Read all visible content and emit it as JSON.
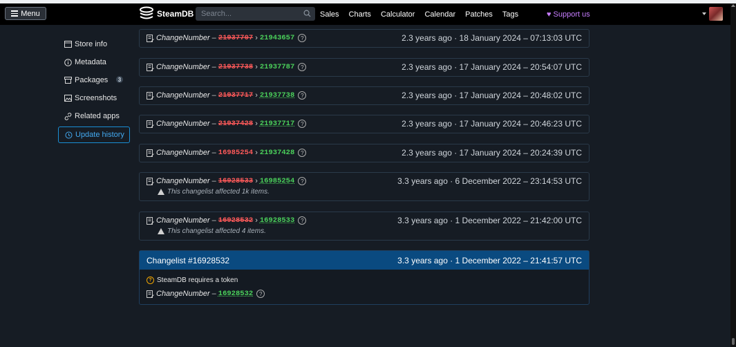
{
  "navbar": {
    "menu_label": "Menu",
    "brand": "SteamDB",
    "search_placeholder": "Search...",
    "links": [
      "Sales",
      "Charts",
      "Calculator",
      "Calendar",
      "Patches",
      "Tags"
    ],
    "support": "Support us"
  },
  "sidebar": {
    "items": [
      {
        "label": "Store info",
        "icon": "store-icon"
      },
      {
        "label": "Metadata",
        "icon": "info-icon"
      },
      {
        "label": "Packages",
        "icon": "package-icon",
        "badge": "3"
      },
      {
        "label": "Screenshots",
        "icon": "image-icon"
      },
      {
        "label": "Related apps",
        "icon": "link-icon"
      },
      {
        "label": "Update history",
        "icon": "history-icon",
        "active": true
      }
    ]
  },
  "history": [
    {
      "field": "ChangeNumber",
      "old": "21937707",
      "new": "21943657",
      "when": "2.3 years ago · 18 January 2024 – 07:13:03 UTC"
    },
    {
      "field": "ChangeNumber",
      "old": "21937738",
      "new": "21937787",
      "when": "2.3 years ago · 17 January 2024 – 20:54:07 UTC"
    },
    {
      "field": "ChangeNumber",
      "old": "21937717",
      "new": "21937738",
      "when": "2.3 years ago · 17 January 2024 – 20:48:02 UTC"
    },
    {
      "field": "ChangeNumber",
      "old": "21937428",
      "new": "21937717",
      "when": "2.3 years ago · 17 January 2024 – 20:46:23 UTC"
    },
    {
      "field": "ChangeNumber",
      "old": "16985254",
      "new": "21937428",
      "when": "2.3 years ago · 17 January 2024 – 20:24:39 UTC"
    },
    {
      "field": "ChangeNumber",
      "old": "16928533",
      "new": "16985254",
      "when": "3.3 years ago · 6 December 2022 – 23:14:53 UTC",
      "note": "This changelist affected 1k items."
    },
    {
      "field": "ChangeNumber",
      "old": "16928532",
      "new": "16928533",
      "when": "3.3 years ago · 1 December 2022 – 21:42:00 UTC",
      "note": "This changelist affected 4 items."
    }
  ],
  "changelist": {
    "title": "Changelist #16928532",
    "when": "3.3 years ago · 1 December 2022 – 21:41:57 UTC",
    "token_note": "SteamDB requires a token",
    "field": "ChangeNumber",
    "new": "16928532"
  },
  "colors": {
    "accent": "#1a8fd6",
    "old_value": "#ff5a5a",
    "new_value": "#4bd15b",
    "support": "#c77dff"
  }
}
